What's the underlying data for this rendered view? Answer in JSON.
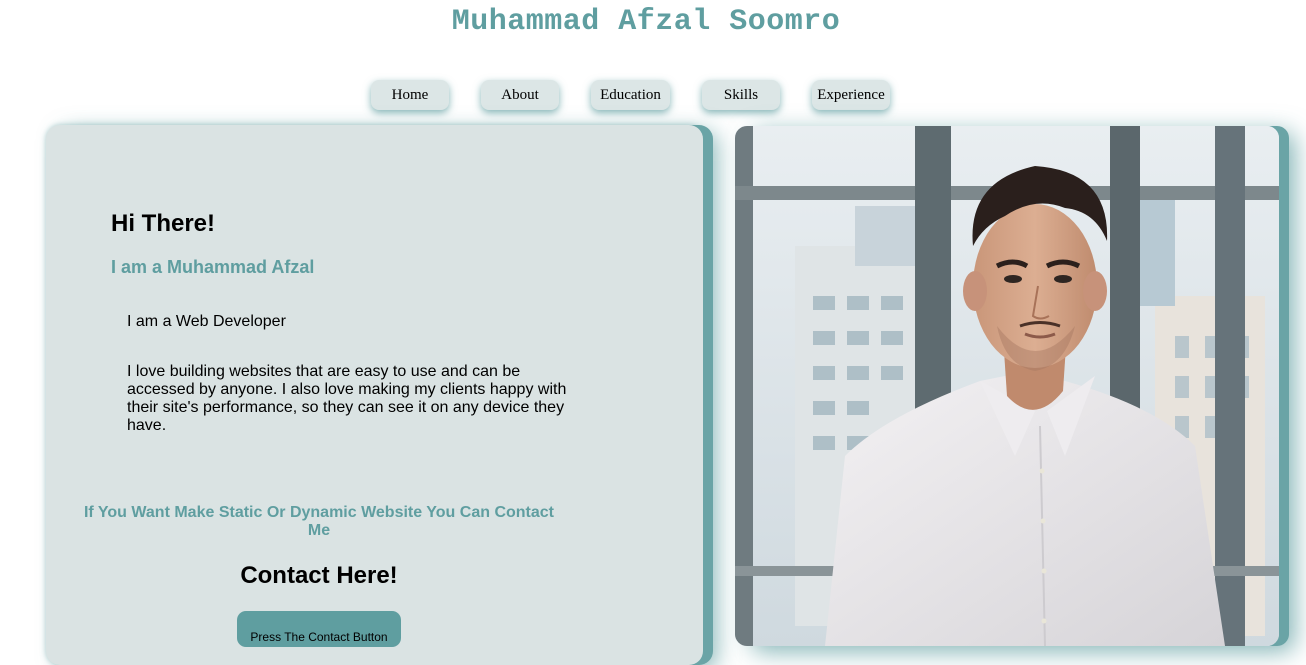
{
  "header": {
    "title": "Muhammad Afzal Soomro"
  },
  "nav": {
    "items": [
      {
        "label": "Home"
      },
      {
        "label": "About"
      },
      {
        "label": "Education"
      },
      {
        "label": "Skills"
      },
      {
        "label": "Experience"
      }
    ]
  },
  "hero": {
    "greeting": "Hi There!",
    "name_line": "I am a Muhammad Afzal",
    "role": "I am a Web Developer",
    "bio": "I love building websites that are easy to use and can be accessed by anyone. I also love making my clients happy with their site's performance, so they can see it on any device they have."
  },
  "contact": {
    "cta": "If You Want Make Static Or Dynamic Website You Can Contact Me",
    "heading": "Contact Here!",
    "button_label": "Press The Contact Button"
  },
  "colors": {
    "accent": "#5f9ea0",
    "panel_bg": "#dae3e3",
    "nav_bg": "#dce6e6"
  },
  "icons": {
    "profile": "profile-photo"
  }
}
